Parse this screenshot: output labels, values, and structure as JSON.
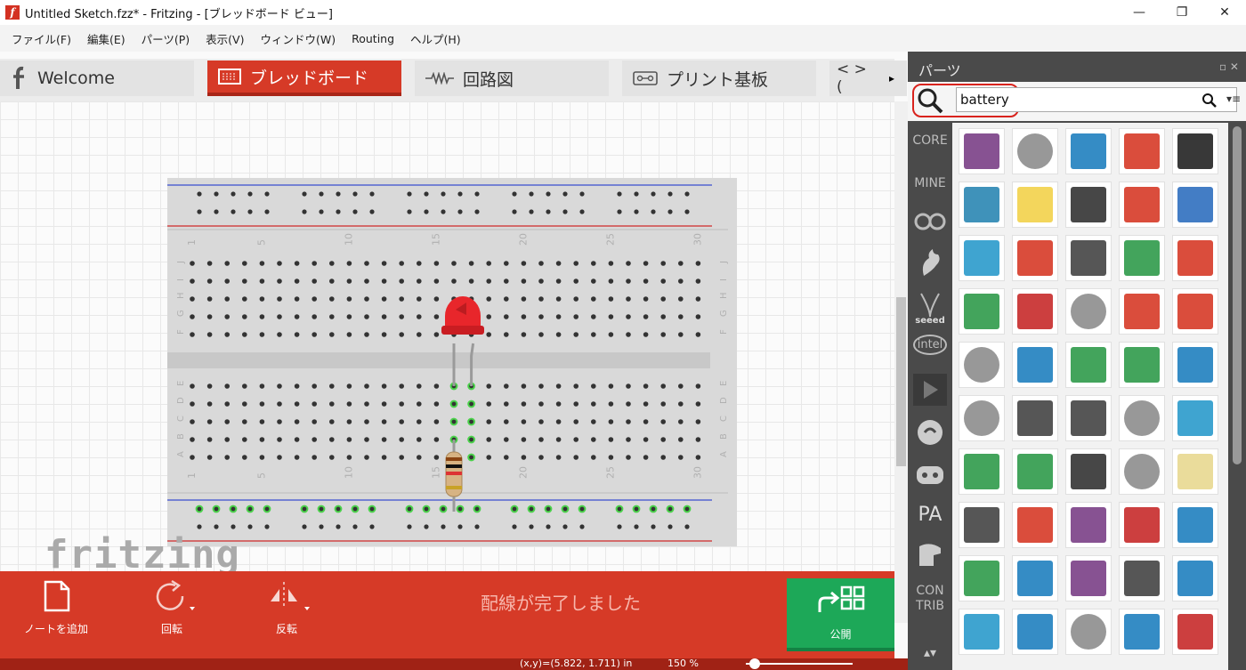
{
  "window": {
    "title": "Untitled Sketch.fzz* - Fritzing - [ブレッドボード ビュー]",
    "minimize": "—",
    "maximize": "❐",
    "close": "✕"
  },
  "menu": [
    "ファイル(F)",
    "編集(E)",
    "パーツ(P)",
    "表示(V)",
    "ウィンドウ(W)",
    "Routing",
    "ヘルプ(H)"
  ],
  "tabs": [
    {
      "label": "Welcome",
      "icon": "fritzing-f-icon"
    },
    {
      "label": "ブレッドボード",
      "icon": "breadboard-icon"
    },
    {
      "label": "回路図",
      "icon": "resistor-symbol-icon"
    },
    {
      "label": "プリント基板",
      "icon": "pcb-icon"
    }
  ],
  "tabs_overflow": "< > (",
  "canvas": {
    "logo": "fritzing",
    "breadboard_numbers": [
      "1",
      "5",
      "10",
      "15",
      "20",
      "25",
      "30"
    ],
    "row_letters_top": [
      "J",
      "I",
      "H",
      "G",
      "F"
    ],
    "row_letters_bottom": [
      "E",
      "D",
      "C",
      "B",
      "A"
    ]
  },
  "toolbar": {
    "add_note": "ノートを追加",
    "rotate": "回転",
    "flip": "反転",
    "status": "配線が完了しました",
    "publish": "公開"
  },
  "statusbar": {
    "coords": "(x,y)=(5.822, 1.711) in",
    "zoom": "150 %"
  },
  "parts_panel": {
    "title": "パーツ",
    "search_value": "battery",
    "bins": [
      "CORE",
      "MINE",
      "seeed",
      "intel",
      "PA",
      "CON TRIB"
    ]
  }
}
